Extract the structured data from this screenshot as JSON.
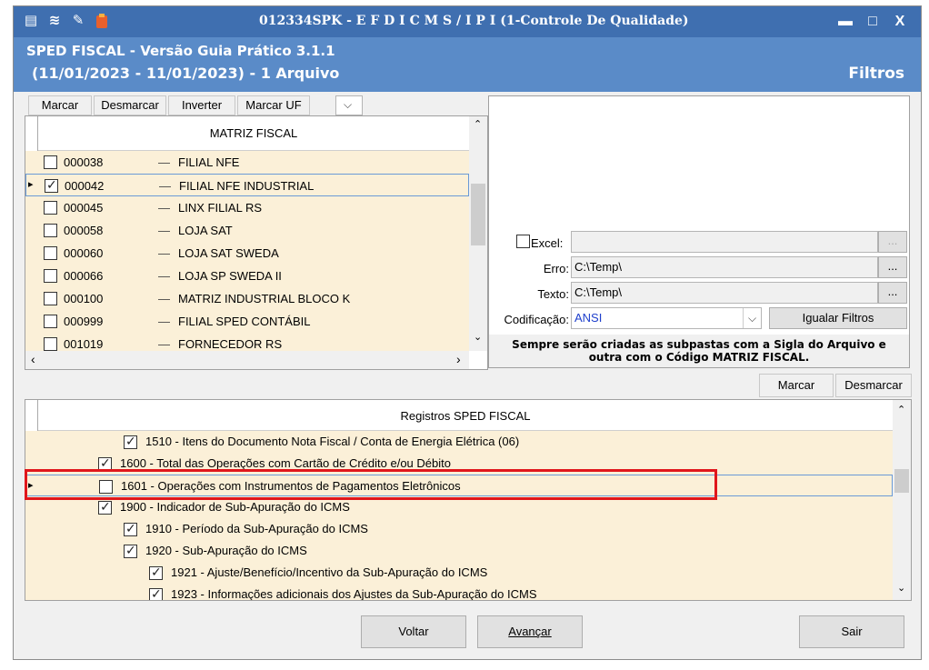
{
  "window": {
    "title": "012334SPK - E F D  I C M S / I P I (1-Controle De Qualidade)",
    "header": {
      "line1": "SPED FISCAL - Versão Guia Prático 3.1.1",
      "line2": "(11/01/2023 - 11/01/2023) - 1 Arquivo",
      "right": "Filtros"
    },
    "controls": {
      "minimize": "▬",
      "maximize": "□",
      "close": "X"
    }
  },
  "toolbar_icons": [
    "menu-icon",
    "traffic-icon",
    "wrench-icon",
    "clipboard-icon"
  ],
  "top_buttons": {
    "marcar": "Marcar",
    "desmarcar": "Desmarcar",
    "inverter": "Inverter",
    "marcar_uf": "Marcar UF"
  },
  "matriz": {
    "header": "MATRIZ FISCAL",
    "rows": [
      {
        "code": "000038",
        "name": "FILIAL NFE",
        "checked": false
      },
      {
        "code": "000042",
        "name": "FILIAL NFE INDUSTRIAL",
        "checked": true,
        "selected": true
      },
      {
        "code": "000045",
        "name": "LINX FILIAL RS",
        "checked": false
      },
      {
        "code": "000058",
        "name": "LOJA SAT",
        "checked": false
      },
      {
        "code": "000060",
        "name": "LOJA SAT SWEDA",
        "checked": false
      },
      {
        "code": "000066",
        "name": "LOJA SP SWEDA II",
        "checked": false
      },
      {
        "code": "000100",
        "name": "MATRIZ INDUSTRIAL BLOCO K",
        "checked": false
      },
      {
        "code": "000999",
        "name": "FILIAL SPED CONTÁBIL",
        "checked": false
      },
      {
        "code": "001019",
        "name": "FORNECEDOR RS",
        "checked": false
      }
    ]
  },
  "filters": {
    "excel_label": "Excel:",
    "excel_value": "",
    "erro_label": "Erro:",
    "erro_value": "C:\\Temp\\",
    "texto_label": "Texto:",
    "texto_value": "C:\\Temp\\",
    "codificacao_label": "Codificação:",
    "codificacao_value": "ANSI",
    "igualar_button": "Igualar Filtros",
    "browse": "...",
    "note_line1": "Sempre serão criadas as subpastas com a Sigla do Arquivo e",
    "note_line2": "outra com o Código MATRIZ FISCAL."
  },
  "registros_buttons": {
    "marcar": "Marcar",
    "desmarcar": "Desmarcar"
  },
  "registros": {
    "header": "Registros SPED FISCAL",
    "rows": [
      {
        "text": "1510 - Itens do Documento Nota Fiscal / Conta de Energia Elétrica (06)",
        "level": 2,
        "checked": true
      },
      {
        "text": "1600 - Total das Operações com Cartão de Crédito e/ou Débito",
        "level": 1,
        "checked": true
      },
      {
        "text": "1601 - Operações com Instrumentos de Pagamentos Eletrônicos",
        "level": 1,
        "checked": false,
        "selected": true
      },
      {
        "text": "1900 - Indicador de Sub-Apuração do ICMS",
        "level": 1,
        "checked": true
      },
      {
        "text": "1910 - Período da Sub-Apuração do ICMS",
        "level": 2,
        "checked": true
      },
      {
        "text": "1920 - Sub-Apuração do ICMS",
        "level": 2,
        "checked": true
      },
      {
        "text": "1921 - Ajuste/Benefício/Incentivo da Sub-Apuração do ICMS",
        "level": 3,
        "checked": true
      },
      {
        "text": "1923 - Informações adicionais dos Ajustes da Sub-Apuração do ICMS",
        "level": 3,
        "checked": true
      }
    ]
  },
  "footer": {
    "voltar": "Voltar",
    "avancar": "Avançar",
    "sair": "Sair"
  }
}
